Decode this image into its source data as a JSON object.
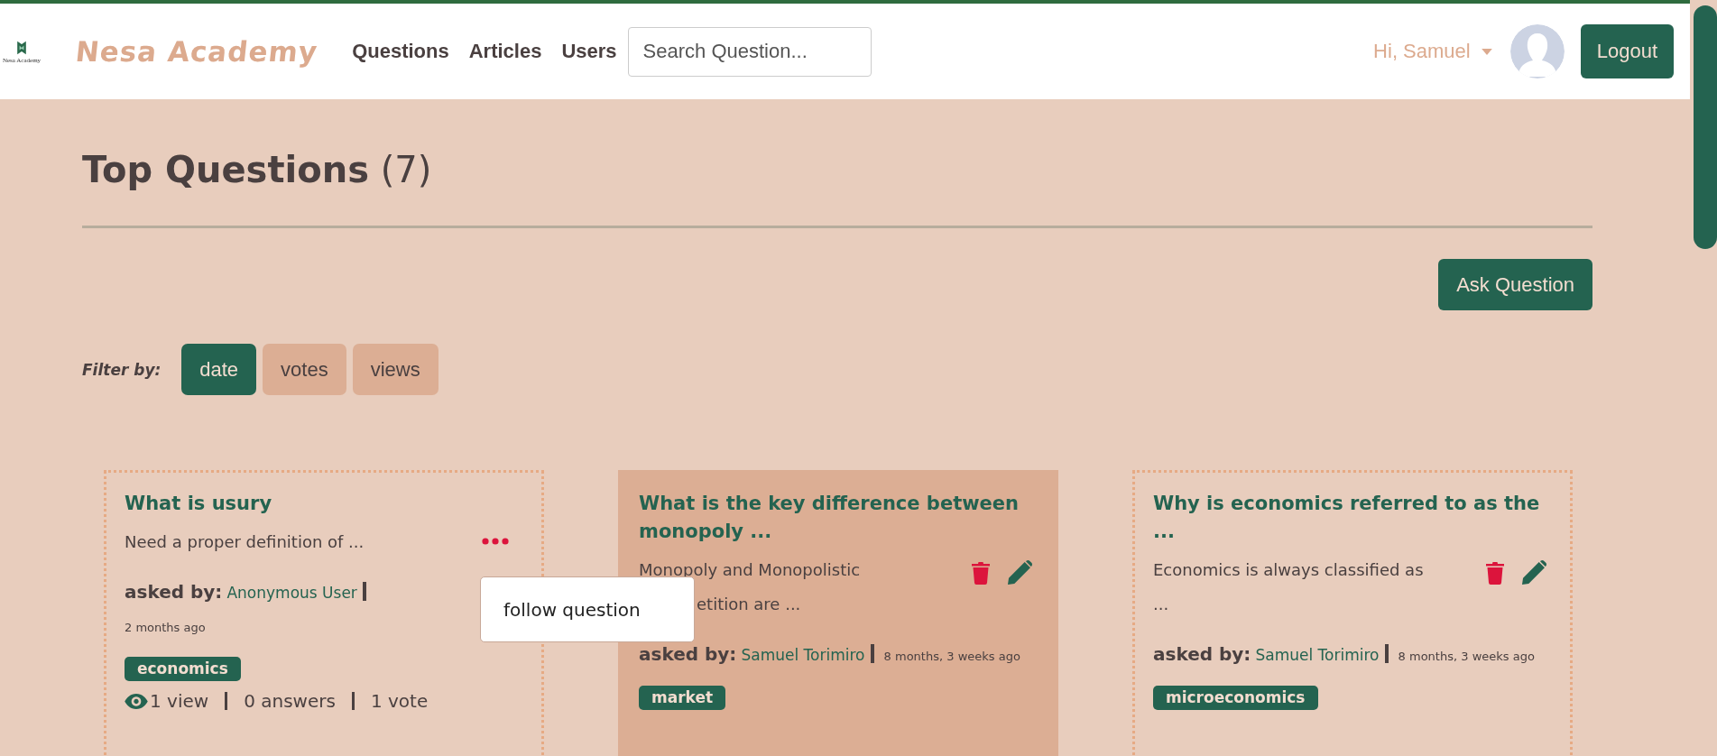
{
  "header": {
    "logo_caption": "Nesa Academy",
    "brand": "Nesa Academy",
    "nav": [
      "Questions",
      "Articles",
      "Users"
    ],
    "search": {
      "placeholder": "Search Question..."
    },
    "greeting": "Hi, Samuel",
    "logout": "Logout"
  },
  "page": {
    "title": "**Top Questions** (7)",
    "ask_button": "Ask Question",
    "filter_label": "Filter by:",
    "filters": [
      {
        "label": "date",
        "selected": true
      },
      {
        "label": "votes",
        "selected": false
      },
      {
        "label": "views",
        "selected": false
      }
    ]
  },
  "questions": [
    {
      "kind": "other",
      "highlighted": false,
      "title": "What is usury",
      "excerpt": [
        {
          "text": "Need a proper definition of ...",
          "clipped": false
        }
      ],
      "asked_label": "asked by:",
      "author": "Anonymous User",
      "time": "2 months ago",
      "tags": [
        "economics"
      ],
      "stats": [
        "1 view",
        "0 answers",
        "1 vote"
      ],
      "menu_open": true,
      "menu_items": [
        "follow question"
      ]
    },
    {
      "kind": "own",
      "highlighted": true,
      "title": "What is the key difference between monopoly ...",
      "excerpt": [
        {
          "text": "Monopoly and Monopolistic",
          "clipped": false
        },
        {
          "text": "etition are ...",
          "clipped": true
        }
      ],
      "asked_label": "asked by:",
      "author": "Samuel Torimiro",
      "time": "8 months, 3 weeks ago",
      "tags": [
        "market"
      ]
    },
    {
      "kind": "own",
      "highlighted": false,
      "title": "Why is economics referred to as the ...",
      "excerpt": [
        {
          "text": "Economics is always classified as",
          "clipped": false
        },
        {
          "text": "...",
          "clipped": false
        }
      ],
      "asked_label": "asked by:",
      "author": "Samuel Torimiro",
      "time": "8 months, 3 weeks ago",
      "tags": [
        "microeconomics"
      ]
    }
  ]
}
